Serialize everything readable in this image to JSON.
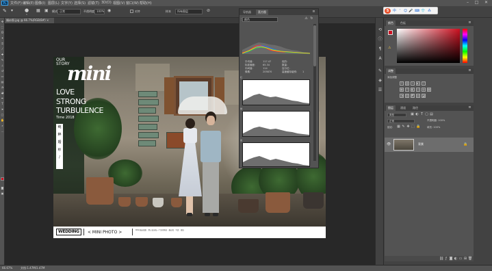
{
  "menubar": {
    "app_logo": "Ps",
    "items": [
      "文件(F)",
      "编辑(E)",
      "图像(I)",
      "图层(L)",
      "文字(Y)",
      "选择(S)",
      "滤镜(T)",
      "3D(D)",
      "视图(V)",
      "窗口(W)",
      "帮助(H)"
    ]
  },
  "window_controls": {
    "minimize": "–",
    "maximize": "□",
    "close": "✕"
  },
  "options": {
    "brush_size": "1",
    "mode_label": "模式",
    "mode_value": "正常",
    "opacity_label": "不透明度",
    "opacity_value": "100%",
    "flow_label": "流量",
    "flow_value": "100%",
    "aligned_label": "对齐",
    "sample_label": "样本",
    "sample_value": "所有图层"
  },
  "ime_bar": {
    "logo": "S",
    "lang": "中",
    "icons": [
      "ʼ",
      "☺",
      "🎤",
      "⌨",
      "👕",
      "⁂"
    ]
  },
  "document": {
    "tab_label": "婚纱照.jpg @ 66.7%(RGB/8#) ×"
  },
  "photo": {
    "our_story": [
      "OUR",
      "STORY"
    ],
    "brand": "mini",
    "love_lines": [
      "LOVE",
      "STRONG",
      "TURBULENCE"
    ],
    "date": "Time 2018",
    "vertical_label": [
      "纯",
      "粹",
      "婚",
      "纱",
      "/"
    ],
    "footer": {
      "wedding_badge": "WEDDING",
      "mini_photo": "< MINI PHOTO >",
      "fine_print": "MINI 婚纱摄影 · 用心记录每一个美好瞬间 · 婚纱照 · 写真 · 旅拍"
    }
  },
  "histogram": {
    "tabs": [
      "导航器",
      "直方图"
    ],
    "active_tab": 1,
    "channel": "颜色",
    "stats_left": [
      {
        "label": "平均值:",
        "value": "117.47"
      },
      {
        "label": "标准偏差:",
        "value": "65.34"
      },
      {
        "label": "中间值:",
        "value": "114"
      },
      {
        "label": "像素:",
        "value": "205870"
      }
    ],
    "stats_right": [
      {
        "label": "色阶:",
        "value": ""
      },
      {
        "label": "数量:",
        "value": ""
      },
      {
        "label": "百分位:",
        "value": ""
      },
      {
        "label": "高速缓存级别:",
        "value": "1"
      }
    ],
    "channel_labels": [
      "红",
      "绿",
      "蓝"
    ]
  },
  "right_strip_icons": [
    "history-icon",
    "info-icon",
    "paragraph-icon",
    "character-icon",
    "brush-settings-icon",
    "3d-icon",
    "properties-icon"
  ],
  "color_panel": {
    "tabs": [
      "颜色",
      "色板"
    ],
    "fg_color": "#cc1020",
    "bg_color": "#ffffff"
  },
  "adjustments_panel": {
    "tabs": [
      "调整"
    ],
    "subtitle": "添加调整"
  },
  "layers_panel": {
    "tabs": [
      "图层",
      "通道",
      "路径"
    ],
    "kind_filter": "类型",
    "blend_mode": "正常",
    "opacity_label": "不透明度: 100%",
    "lock_label": "锁定:",
    "fill_label": "填充: 100%",
    "layer_name": "背景"
  },
  "status": {
    "zoom": "66.67%",
    "doc_info": "文档:1.47M/1.47M"
  }
}
